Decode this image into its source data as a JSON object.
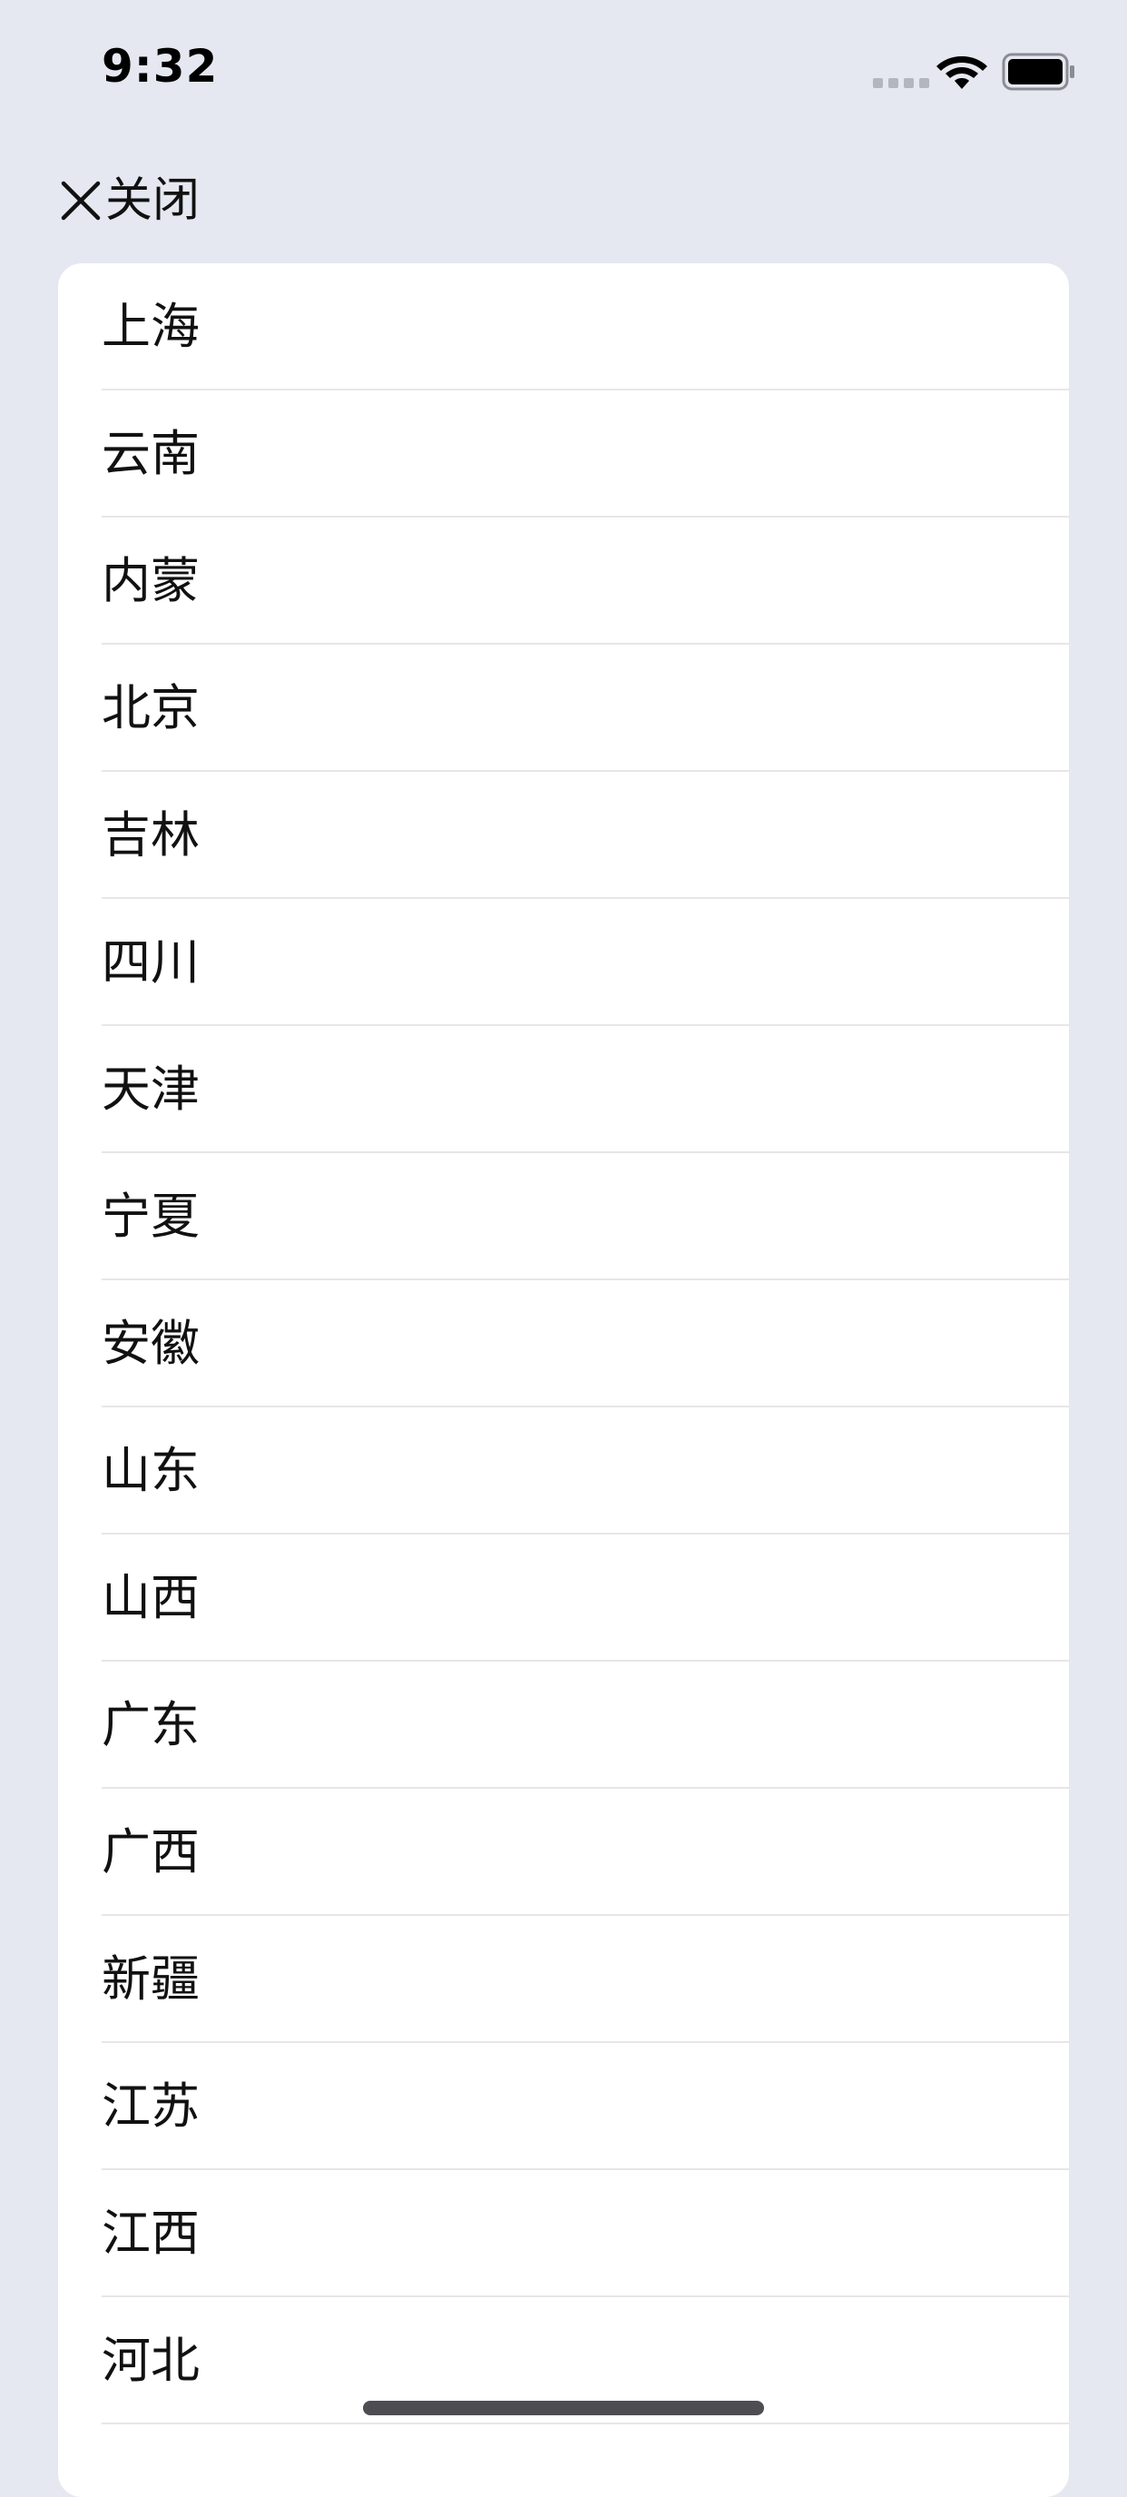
{
  "status_bar": {
    "time": "9:32",
    "signal_icon": "signal-icon",
    "wifi_icon": "wifi-icon",
    "battery_icon": "battery-icon"
  },
  "header": {
    "close_icon": "close-icon",
    "close_label": "关闭"
  },
  "provinces": [
    "上海",
    "云南",
    "内蒙",
    "北京",
    "吉林",
    "四川",
    "天津",
    "宁夏",
    "安徽",
    "山东",
    "山西",
    "广东",
    "广西",
    "新疆",
    "江苏",
    "江西",
    "河北"
  ],
  "colors": {
    "background": "#e5e8f1",
    "list_background": "#ffffff",
    "separator": "#e6e6ea",
    "text": "#111111"
  }
}
